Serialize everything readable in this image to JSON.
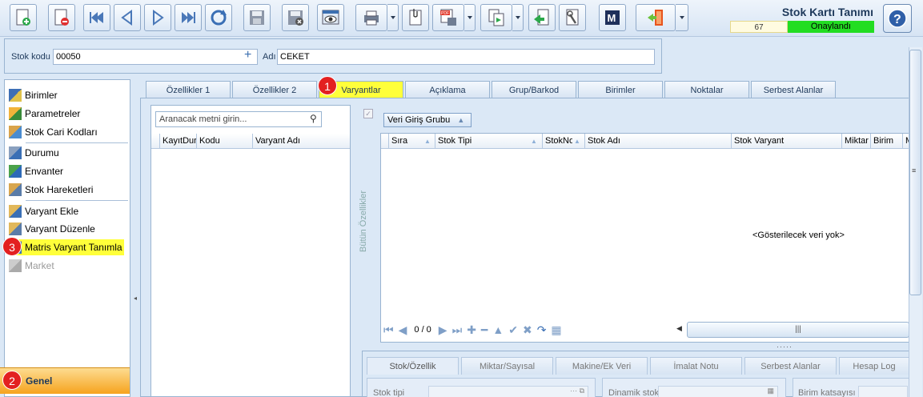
{
  "window": {
    "title": "Stok Kartı Tanımı",
    "record_count": "67",
    "status": "Onaylandı",
    "status_color": "#22dd22"
  },
  "toolbar": {
    "buttons": [
      {
        "name": "new-record-icon"
      },
      {
        "name": "delete-record-icon"
      },
      {
        "name": "first-record-icon"
      },
      {
        "name": "previous-record-icon"
      },
      {
        "name": "next-record-icon"
      },
      {
        "name": "last-record-icon"
      },
      {
        "name": "refresh-icon"
      },
      {
        "name": "save-icon"
      },
      {
        "name": "save-close-icon"
      },
      {
        "name": "preview-icon"
      },
      {
        "name": "print-icon"
      },
      {
        "name": "attach-icon"
      },
      {
        "name": "pdf-save-icon"
      },
      {
        "name": "copy-icon"
      },
      {
        "name": "import-icon"
      },
      {
        "name": "tools-icon"
      },
      {
        "name": "m-icon"
      },
      {
        "name": "exit-icon"
      }
    ]
  },
  "header": {
    "stok_kodu_label": "Stok kodu",
    "stok_kodu_value": "00050",
    "adi_label": "Adı",
    "adi_value": "CEKET"
  },
  "sidebar": {
    "items": [
      {
        "label": "Birimler",
        "icon": "units-icon"
      },
      {
        "label": "Parametreler",
        "icon": "parameters-icon"
      },
      {
        "label": "Stok Cari Kodları",
        "icon": "stock-account-codes-icon"
      },
      {
        "label": "Durumu",
        "icon": "status-icon"
      },
      {
        "label": "Envanter",
        "icon": "inventory-icon"
      },
      {
        "label": "Stok Hareketleri",
        "icon": "stock-movements-icon"
      },
      {
        "label": "Varyant Ekle",
        "icon": "add-variant-icon"
      },
      {
        "label": "Varyant Düzenle",
        "icon": "edit-variant-icon"
      },
      {
        "label": "Matris Varyant Tanımla",
        "icon": "matrix-variant-icon"
      },
      {
        "label": "Market",
        "icon": "market-icon"
      }
    ],
    "footer": "Genel"
  },
  "tabs": [
    "Özellikler 1",
    "Özellikler 2",
    "Varyantlar",
    "Açıklama",
    "Grup/Barkod",
    "Birimler",
    "Noktalar",
    "Serbest Alanlar"
  ],
  "left_list": {
    "search_placeholder": "Aranacak metni girin...",
    "columns": [
      "KayıtDur",
      "Kodu",
      "Varyant Adı"
    ]
  },
  "strip_label": "Bütün Özellikler",
  "right_grid": {
    "group_button": "Veri Giriş Grubu",
    "columns": [
      "Sıra",
      "Stok Tipi",
      "StokNo",
      "Stok Adı",
      "Stok Varyant",
      "Miktar",
      "Birim",
      "M"
    ],
    "empty_message": "<Gösterilecek veri yok>",
    "pager": "0 / 0"
  },
  "bottom_tabs": [
    "Stok/Özellik",
    "Miktar/Sayısal",
    "Makine/Ek Veri",
    "İmalat Notu",
    "Serbest Alanlar",
    "Hesap Log"
  ],
  "bottom_fields": {
    "stok_tipi": "Stok tipi",
    "dinamik_stok": "Dinamik stok",
    "birim_katsayisi": "Birim katsayısı"
  },
  "badges": [
    "1",
    "2",
    "3"
  ],
  "colors": {
    "highlight": "#ffff3a",
    "badge": "#e32020",
    "footer": "#f6a31e"
  }
}
